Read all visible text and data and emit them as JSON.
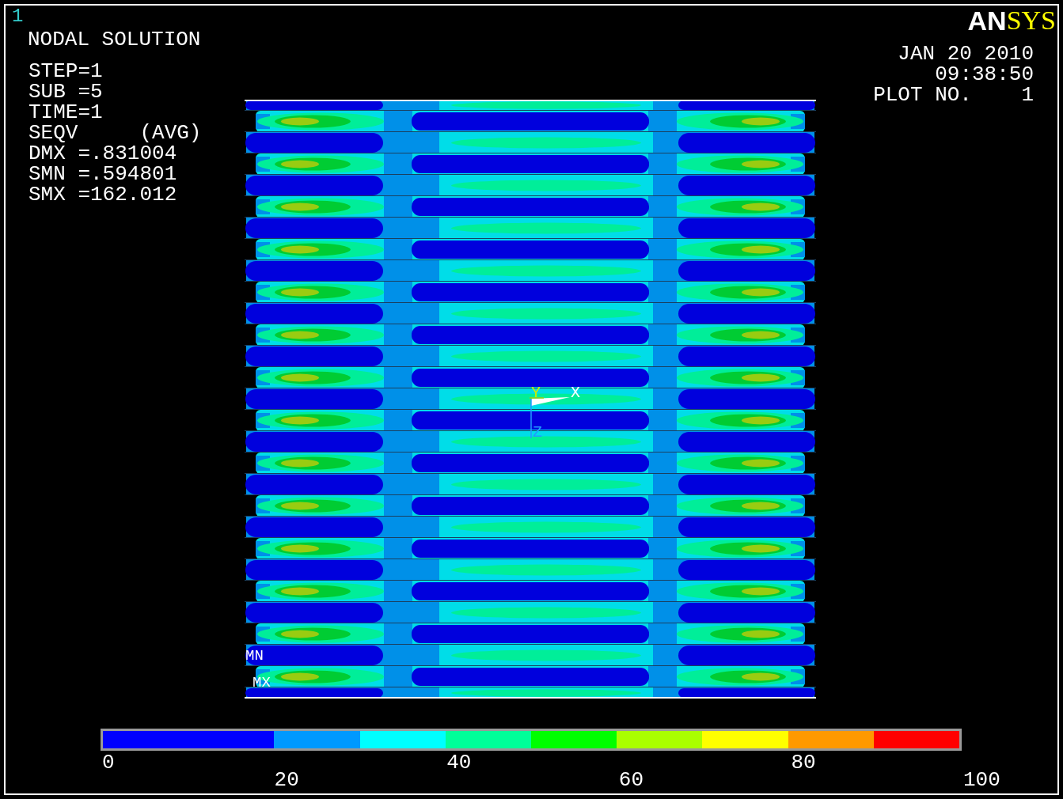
{
  "viewport": {
    "number": "1"
  },
  "info": {
    "title": "NODAL SOLUTION",
    "lines": [
      "STEP=1",
      "SUB =5",
      "TIME=1",
      "SEQV     (AVG)",
      "DMX =.831004",
      "SMN =.594801",
      "SMX =162.012"
    ]
  },
  "logo": {
    "part_1": "AN",
    "part_2": "SYS"
  },
  "stamp": {
    "date": "JAN 20 2010",
    "time": "09:38:50",
    "plot_no": "PLOT NO.    1"
  },
  "plot": {
    "triad": {
      "x": "X",
      "y": "Y",
      "z": "Z"
    },
    "min_label": "MN",
    "max_label": "MX"
  },
  "color_bar": {
    "bands": [
      {
        "color": "#0000ff"
      },
      {
        "color": "#0099ff"
      },
      {
        "color": "#00ffff"
      },
      {
        "color": "#00ff99"
      },
      {
        "color": "#00ff00"
      },
      {
        "color": "#aaff00"
      },
      {
        "color": "#ffff00"
      },
      {
        "color": "#ff9900"
      },
      {
        "color": "#ff0000"
      }
    ],
    "ticks": [
      "0",
      "20",
      "40",
      "60",
      "80",
      "100"
    ]
  }
}
